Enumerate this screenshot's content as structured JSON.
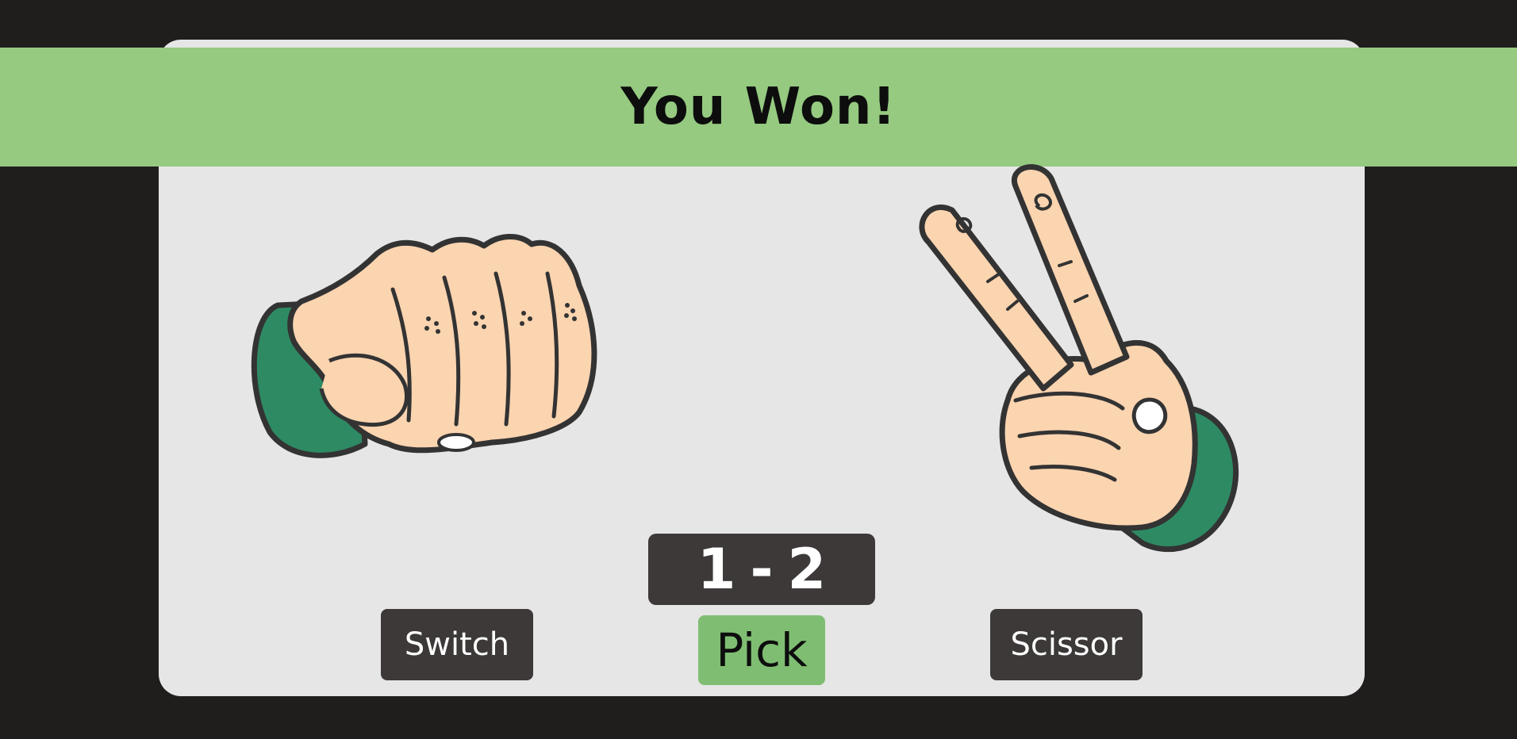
{
  "banner": {
    "text": "You Won!"
  },
  "player_hand": {
    "icon": "fist-rock-icon"
  },
  "opponent_hand": {
    "icon": "peace-scissors-icon"
  },
  "score": {
    "left": "1",
    "separator": "-",
    "right": "2"
  },
  "buttons": {
    "switch_label": "Switch",
    "pick_label": "Pick",
    "choice_label": "Scissor"
  },
  "colors": {
    "background": "#201d1d",
    "card": "#e6e6e6",
    "banner": "#95ca80",
    "dark_button": "#3d3939",
    "pick_button": "#7fbe72",
    "sleeve": "#2e8a63",
    "skin": "#fbd4b0"
  }
}
